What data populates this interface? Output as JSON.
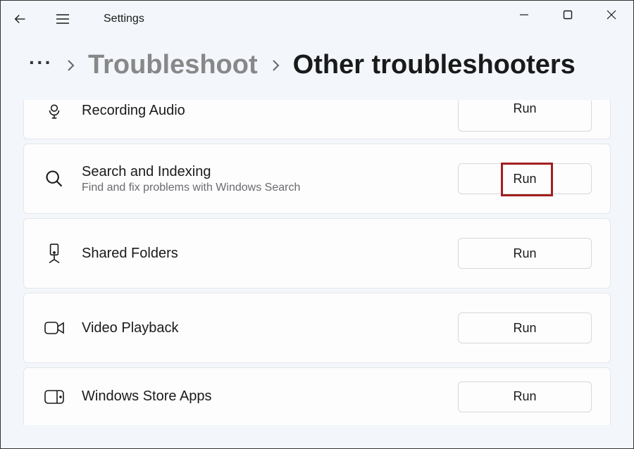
{
  "app": {
    "title": "Settings"
  },
  "breadcrumb": {
    "ellipsis": "···",
    "parent": "Troubleshoot",
    "current": "Other troubleshooters"
  },
  "buttons": {
    "run": "Run"
  },
  "troubleshooters": [
    {
      "id": "recording-audio",
      "title": "Recording Audio",
      "description": "",
      "icon": "microphone-icon"
    },
    {
      "id": "search-indexing",
      "title": "Search and Indexing",
      "description": "Find and fix problems with Windows Search",
      "icon": "search-icon",
      "highlighted": true
    },
    {
      "id": "shared-folders",
      "title": "Shared Folders",
      "description": "",
      "icon": "shared-folders-icon"
    },
    {
      "id": "video-playback",
      "title": "Video Playback",
      "description": "",
      "icon": "video-icon"
    },
    {
      "id": "windows-store-apps",
      "title": "Windows Store Apps",
      "description": "",
      "icon": "store-apps-icon"
    }
  ]
}
